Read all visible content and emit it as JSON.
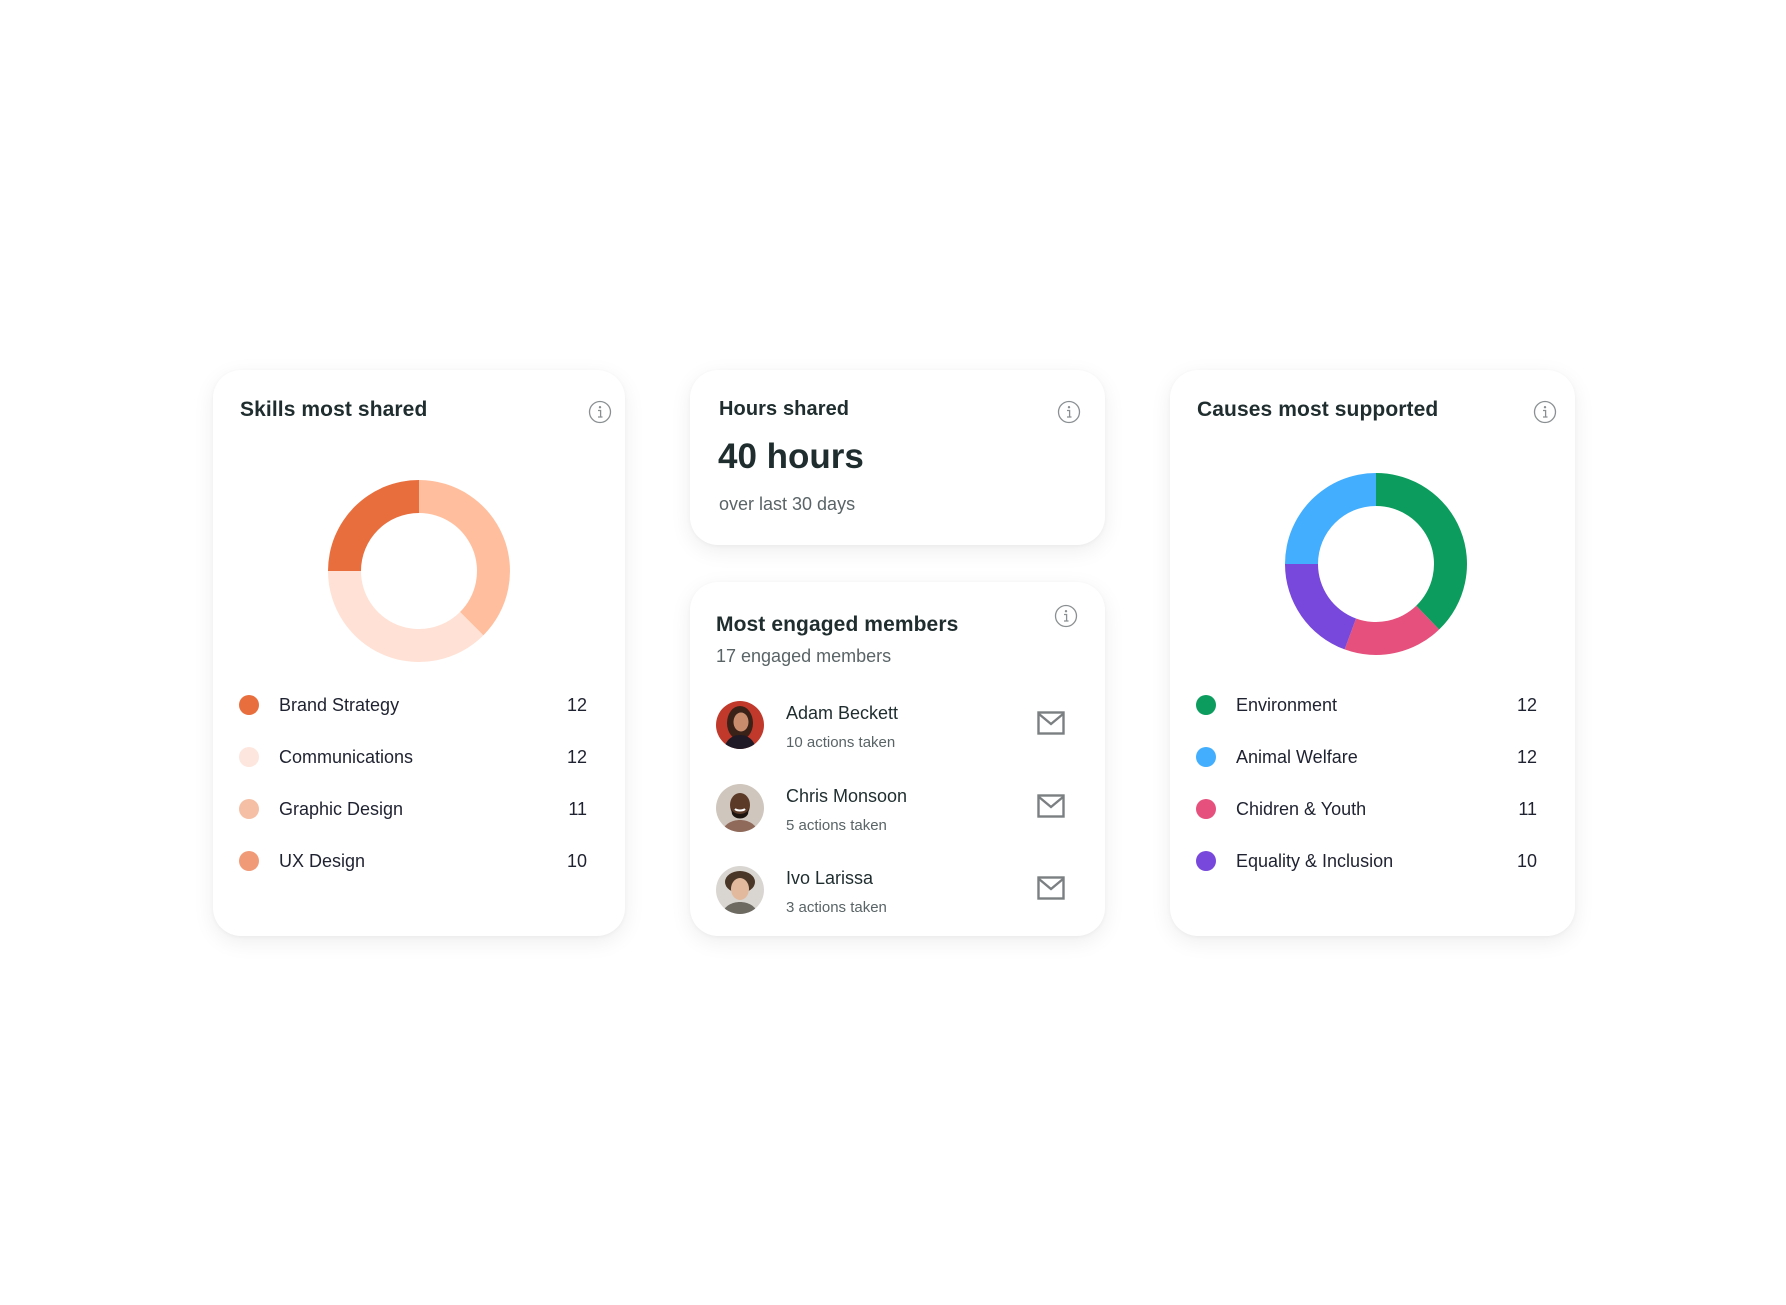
{
  "skills_card": {
    "title": "Skills most shared",
    "info_icon": "info-icon",
    "legend": [
      {
        "label": "Brand Strategy",
        "value": "12",
        "color": "#E86E3E"
      },
      {
        "label": "Communications",
        "value": "12",
        "color": "#FDE6DD"
      },
      {
        "label": "Graphic Design",
        "value": "11",
        "color": "#F5BFA5"
      },
      {
        "label": "UX Design",
        "value": "10",
        "color": "#F09A78"
      }
    ]
  },
  "hours_card": {
    "title": "Hours shared",
    "info_icon": "info-icon",
    "value": "40 hours",
    "subtitle": "over last 30 days"
  },
  "members_card": {
    "title": "Most engaged members",
    "info_icon": "info-icon",
    "subtitle": "17 engaged members",
    "members": [
      {
        "name": "Adam Beckett",
        "actions": "10 actions taken",
        "action_icon": "mail-icon"
      },
      {
        "name": "Chris Monsoon",
        "actions": "5 actions taken",
        "action_icon": "mail-icon"
      },
      {
        "name": "Ivo Larissa",
        "actions": "3 actions taken",
        "action_icon": "mail-icon"
      }
    ]
  },
  "causes_card": {
    "title": "Causes most supported",
    "info_icon": "info-icon",
    "legend": [
      {
        "label": "Environment",
        "value": "12",
        "color": "#0C9D5E"
      },
      {
        "label": "Animal Welfare",
        "value": "12",
        "color": "#42AEFD"
      },
      {
        "label": "Chidren & Youth",
        "value": "11",
        "color": "#E5507D"
      },
      {
        "label": "Equality & Inclusion",
        "value": "10",
        "color": "#7748DB"
      }
    ]
  },
  "chart_data": [
    {
      "type": "pie",
      "title": "Skills most shared",
      "donut": true,
      "segments_shown": [
        {
          "name": "segment-light",
          "fraction": 0.375,
          "color": "#FFBF9E"
        },
        {
          "name": "segment-pale",
          "fraction": 0.375,
          "color": "#FFE1D5"
        },
        {
          "name": "segment-dark",
          "fraction": 0.25,
          "color": "#E86E3E"
        }
      ],
      "categories": [
        "Brand Strategy",
        "Communications",
        "Graphic Design",
        "UX Design"
      ],
      "values": [
        12,
        12,
        11,
        10
      ]
    },
    {
      "type": "pie",
      "title": "Causes most supported",
      "donut": true,
      "segments_shown": [
        {
          "name": "Environment",
          "fraction": 0.378,
          "color": "#0C9D5E"
        },
        {
          "name": "Chidren & Youth",
          "fraction": 0.178,
          "color": "#E5507D"
        },
        {
          "name": "Equality & Inclusion",
          "fraction": 0.194,
          "color": "#7748DB"
        },
        {
          "name": "Animal Welfare",
          "fraction": 0.25,
          "color": "#42AEFD"
        }
      ],
      "categories": [
        "Environment",
        "Animal Welfare",
        "Chidren & Youth",
        "Equality & Inclusion"
      ],
      "values": [
        12,
        12,
        11,
        10
      ]
    }
  ]
}
